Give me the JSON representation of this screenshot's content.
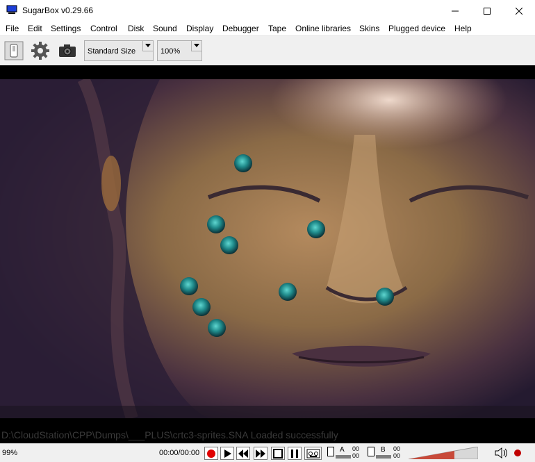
{
  "window": {
    "title": "SugarBox v0.29.66",
    "buttons": [
      "minimize-icon",
      "maximize-icon",
      "close-icon"
    ]
  },
  "menu": [
    "File",
    "Edit",
    "Settings",
    "Control",
    "Disk",
    "Sound",
    "Display",
    "Debugger",
    "Tape",
    "Online libraries",
    "Skins",
    "Plugged device",
    "Help"
  ],
  "toolbar": {
    "icons": [
      "power-switch-icon",
      "gear-icon",
      "camera-icon"
    ],
    "size_select": "Standard Size",
    "zoom_select": "100%"
  },
  "screen": {
    "status_message": "D:\\CloudStation\\CPP\\Dumps\\___PLUS\\crtc3-sprites.SNA Loaded successfully",
    "image": "buddha-face-with-teal-sprite-orbs"
  },
  "statusbar": {
    "speed": "99%",
    "time": "00:00/00:00",
    "tape_controls": [
      "record-icon",
      "play-icon",
      "rewind-icon",
      "fast-forward-icon",
      "stop-icon",
      "pause-icon",
      "cassette-icon"
    ],
    "drive_a": {
      "letter": "A",
      "count_top": "00",
      "count_bottom": "00"
    },
    "drive_b": {
      "letter": "B",
      "count_top": "00",
      "count_bottom": "00"
    },
    "icons": [
      "volume-icon",
      "record-indicator-icon"
    ]
  },
  "colors": {
    "record": "#e00000",
    "orb": "#1f8a8a",
    "bronze": "#8a6a46"
  }
}
